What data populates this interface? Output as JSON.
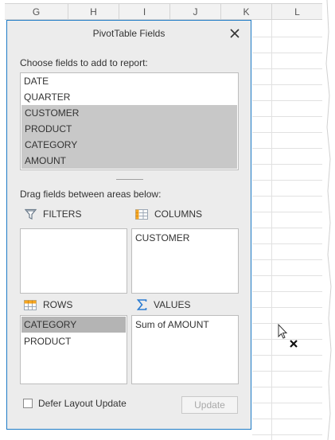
{
  "sheet": {
    "columns": [
      "G",
      "H",
      "I",
      "J",
      "K",
      "L"
    ]
  },
  "panel": {
    "title": "PivotTable Fields",
    "choose_label": "Choose fields to add to report:",
    "fields": [
      {
        "label": "DATE",
        "selected": false
      },
      {
        "label": "QUARTER",
        "selected": false
      },
      {
        "label": "CUSTOMER",
        "selected": true
      },
      {
        "label": "PRODUCT",
        "selected": true
      },
      {
        "label": "CATEGORY",
        "selected": true
      },
      {
        "label": "AMOUNT",
        "selected": true
      }
    ],
    "drag_label": "Drag fields between areas below:",
    "areas": {
      "filters": {
        "label": "FILTERS",
        "items": []
      },
      "columns": {
        "label": "COLUMNS",
        "items": [
          "CUSTOMER"
        ]
      },
      "rows": {
        "label": "ROWS",
        "items": [
          "CATEGORY",
          "PRODUCT"
        ],
        "selected_index": 0
      },
      "values": {
        "label": "VALUES",
        "items": [
          "Sum of AMOUNT"
        ]
      }
    },
    "defer_label": "Defer Layout Update",
    "defer_checked": false,
    "update_label": "Update",
    "accent_color": "#1e7bc6"
  },
  "icons": {
    "close": "close-icon",
    "filters": "funnel-icon",
    "columns": "columns-grid-icon",
    "rows": "rows-grid-icon",
    "values": "sigma-icon",
    "cursor": "drag-cursor-icon"
  }
}
